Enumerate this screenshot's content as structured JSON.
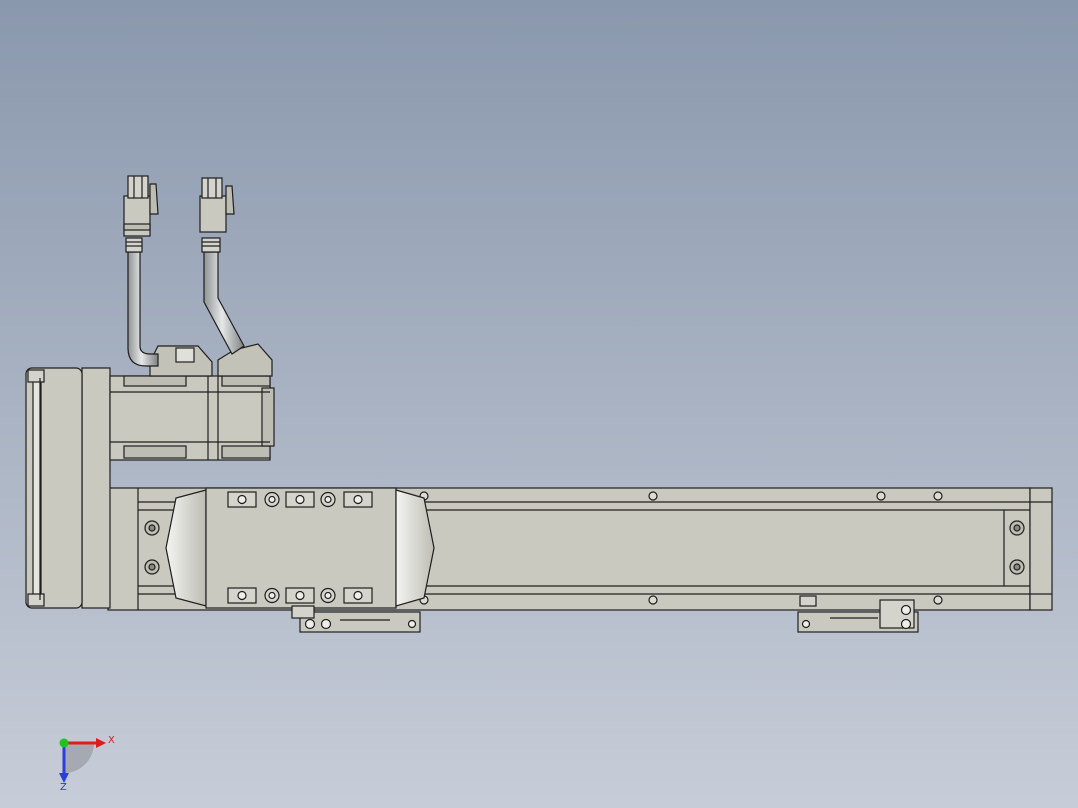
{
  "viewport": {
    "background_top": "#8a98ad",
    "background_bottom": "#c7cdd8"
  },
  "model": {
    "part_fill": "#c9c9bf",
    "part_fill_dark": "#aeada2",
    "cable_fill": "#bfc2c2",
    "edge_color": "#1e1e1e"
  },
  "triad": {
    "x_label": "X",
    "z_label": "Z",
    "x_color": "#e01b1b",
    "y_color": "#1fc21f",
    "z_color": "#2b3fd6"
  }
}
